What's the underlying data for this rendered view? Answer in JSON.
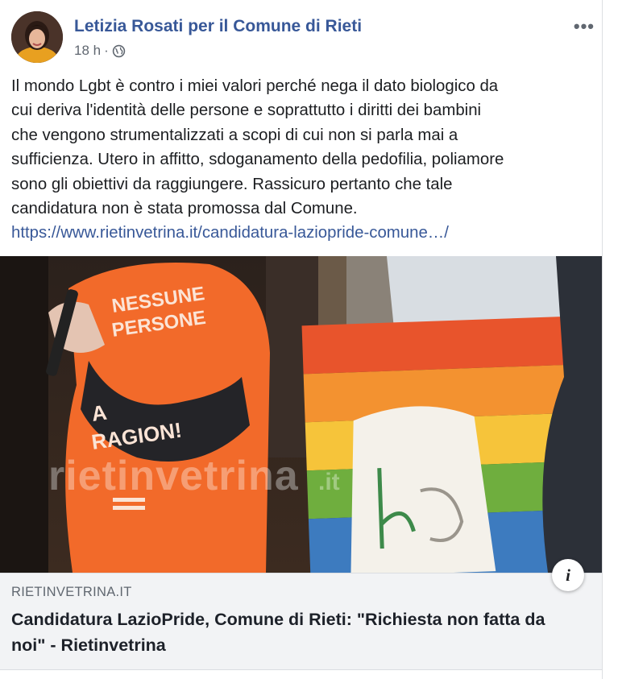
{
  "post": {
    "author": "Letizia Rosati per il Comune di Rieti",
    "time": "18 h",
    "separator": "·",
    "privacy_icon": "globe-icon",
    "more_label": "•••",
    "body_text": "Il mondo Lgbt è contro i miei valori perché nega il dato biologico da\ncui deriva l'identità delle persone e soprattutto i diritti dei bambini\nche vengono strumentalizzati a scopi di cui non si parla mai a\nsufficienza. Utero in affitto, sdoganamento della pedofilia, poliamore\nsono gli obiettivi da raggiungere. Rassicuro pertanto che tale\ncandidatura non è stata promossa dal Comune.",
    "link_text": "https://www.rietinvetrina.it/candidatura-laziopride-comune…/"
  },
  "preview": {
    "image_watermark": "rietinvetrina",
    "watermark_suffix": ".it",
    "shirt_text_1": "NESSUNE",
    "shirt_text_2": "PERSONE",
    "shirt_text_3": "A",
    "shirt_text_4": "RAGION!",
    "info_label": "i",
    "domain": "RIETINVETRINA.IT",
    "title": "Candidatura LazioPride, Comune di Rieti: \"Richiesta non fatta da noi\" - Rietinvetrina"
  },
  "colors": {
    "link_blue": "#385898",
    "meta_gray": "#606770",
    "caption_bg": "#f2f3f5"
  }
}
